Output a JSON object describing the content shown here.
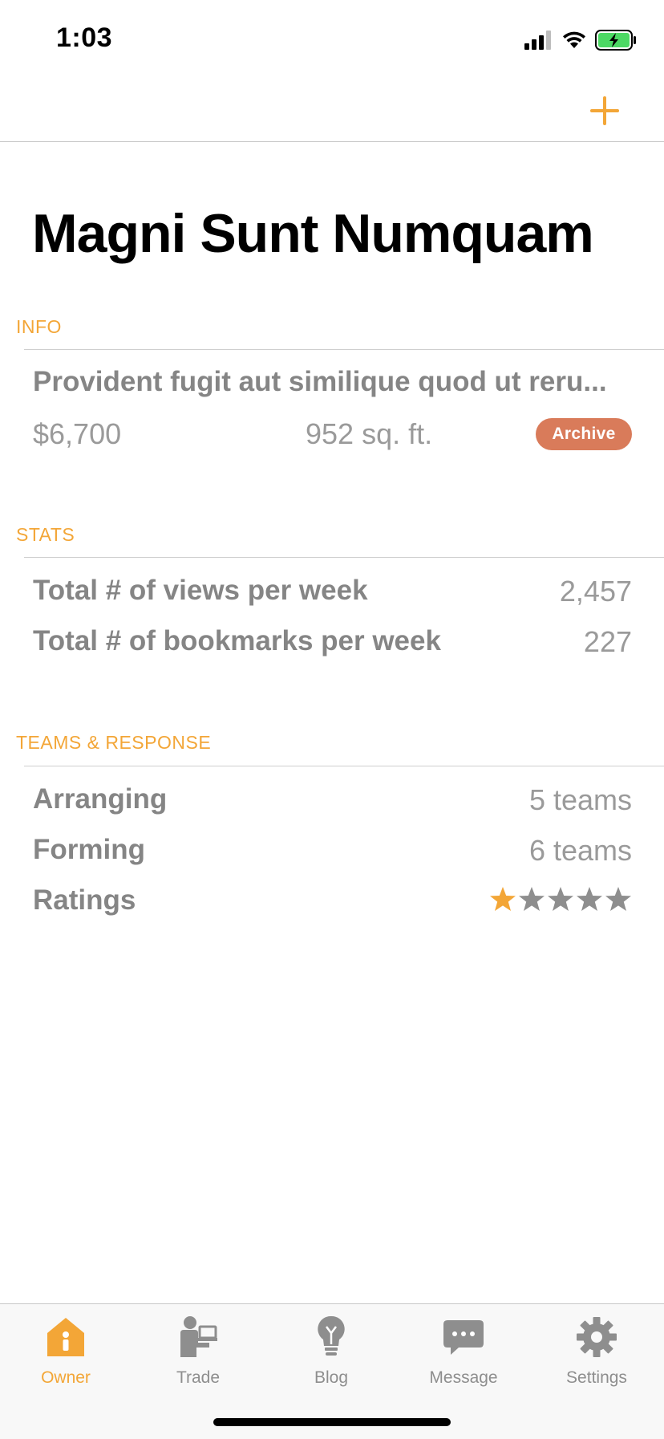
{
  "status_bar": {
    "time": "1:03"
  },
  "nav": {
    "add_icon": "plus-icon",
    "accent_color": "#f3a637"
  },
  "page": {
    "title": "Magni Sunt Numquam"
  },
  "info": {
    "header": "INFO",
    "description": "Provident fugit aut similique quod ut reru...",
    "price": "$6,700",
    "area": "952 sq. ft.",
    "archive_label": "Archive",
    "archive_color": "#d97b5a"
  },
  "stats": {
    "header": "STATS",
    "rows": [
      {
        "label": "Total # of views per week",
        "value": "2,457"
      },
      {
        "label": "Total # of bookmarks per week",
        "value": "227"
      }
    ]
  },
  "teams": {
    "header": "TEAMS & RESPONSE",
    "rows": [
      {
        "label": "Arranging",
        "value": "5 teams"
      },
      {
        "label": "Forming",
        "value": "6 teams"
      }
    ],
    "ratings_label": "Ratings",
    "rating": 1,
    "rating_max": 5
  },
  "tab_bar": {
    "items": [
      {
        "label": "Owner",
        "icon": "house-icon",
        "active": true
      },
      {
        "label": "Trade",
        "icon": "person-laptop-icon",
        "active": false
      },
      {
        "label": "Blog",
        "icon": "lightbulb-icon",
        "active": false
      },
      {
        "label": "Message",
        "icon": "chat-bubble-icon",
        "active": false
      },
      {
        "label": "Settings",
        "icon": "gear-icon",
        "active": false
      }
    ]
  }
}
